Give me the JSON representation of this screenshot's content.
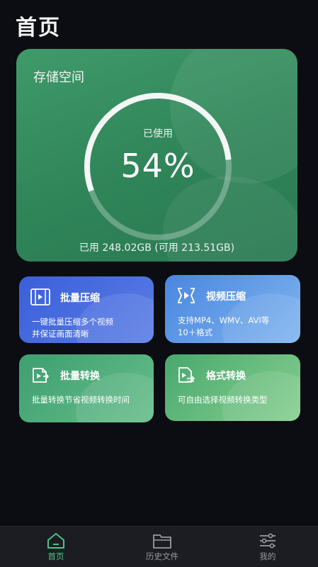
{
  "header": {
    "title": "首页"
  },
  "storage": {
    "title": "存储空间",
    "used_label": "已使用",
    "used_percent_text": "54%",
    "used_fraction": 0.54,
    "detail": "已用 248.02GB (可用 213.51GB)"
  },
  "tiles": [
    {
      "title": "批量压缩",
      "desc": "一键批量压缩多个视频\n并保证画面清晰",
      "icon": "batch-compress-icon"
    },
    {
      "title": "视频压缩",
      "desc": "支持MP4、WMV、AVI等\n10＋格式",
      "icon": "video-compress-icon"
    },
    {
      "title": "批量转换",
      "desc": "批量转换节省视频转换时间",
      "icon": "batch-convert-icon"
    },
    {
      "title": "格式转换",
      "desc": "可自由选择视频转换类型",
      "icon": "format-convert-icon"
    }
  ],
  "nav": {
    "items": [
      {
        "label": "首页",
        "icon": "home-icon",
        "active": true
      },
      {
        "label": "历史文件",
        "icon": "folder-icon",
        "active": false
      },
      {
        "label": "我的",
        "icon": "sliders-icon",
        "active": false
      }
    ]
  },
  "colors": {
    "storage_card": "#2f8458",
    "batch_compress": "#3a5fd9",
    "video_compress": "#4a86e0",
    "batch_convert": "#3e9f70",
    "format_convert": "#49a86e",
    "nav_active": "#4cc38a"
  }
}
